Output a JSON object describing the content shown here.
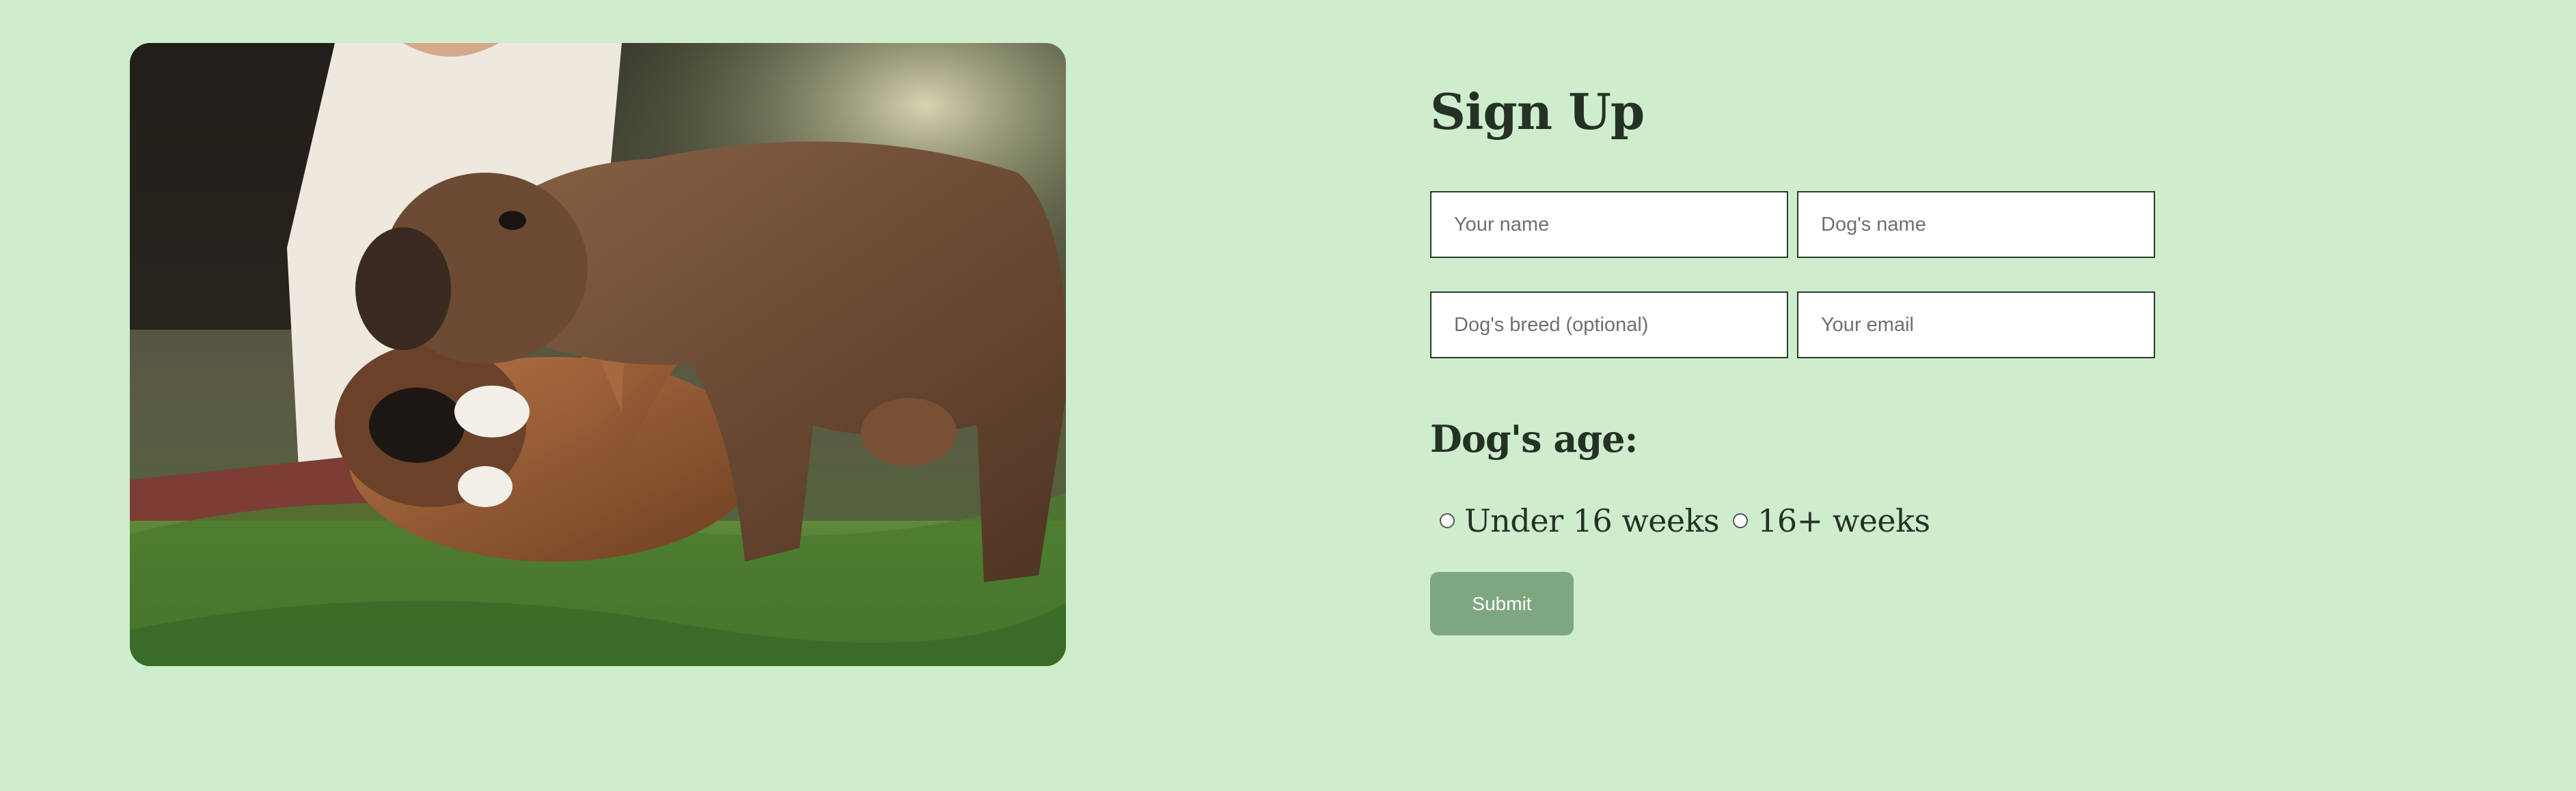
{
  "photo": {
    "subject": "two-puppies-playing-on-grass"
  },
  "form": {
    "title": "Sign Up",
    "fields": {
      "your_name": {
        "value": "",
        "placeholder": "Your name"
      },
      "dog_name": {
        "value": "",
        "placeholder": "Dog's name"
      },
      "dog_breed": {
        "value": "",
        "placeholder": "Dog's breed (optional)"
      },
      "your_email": {
        "value": "",
        "placeholder": "Your email"
      }
    },
    "age_title": "Dog's age:",
    "age_options": [
      {
        "label": "Under 16 weeks",
        "selected": false
      },
      {
        "label": "16+ weeks",
        "selected": false
      }
    ],
    "submit_label": "Submit"
  },
  "colors": {
    "background": "#cdedcd",
    "heading": "#263126",
    "field_border": "#2a3a2c",
    "button": "#7ea67f",
    "button_text": "#ffffff"
  }
}
